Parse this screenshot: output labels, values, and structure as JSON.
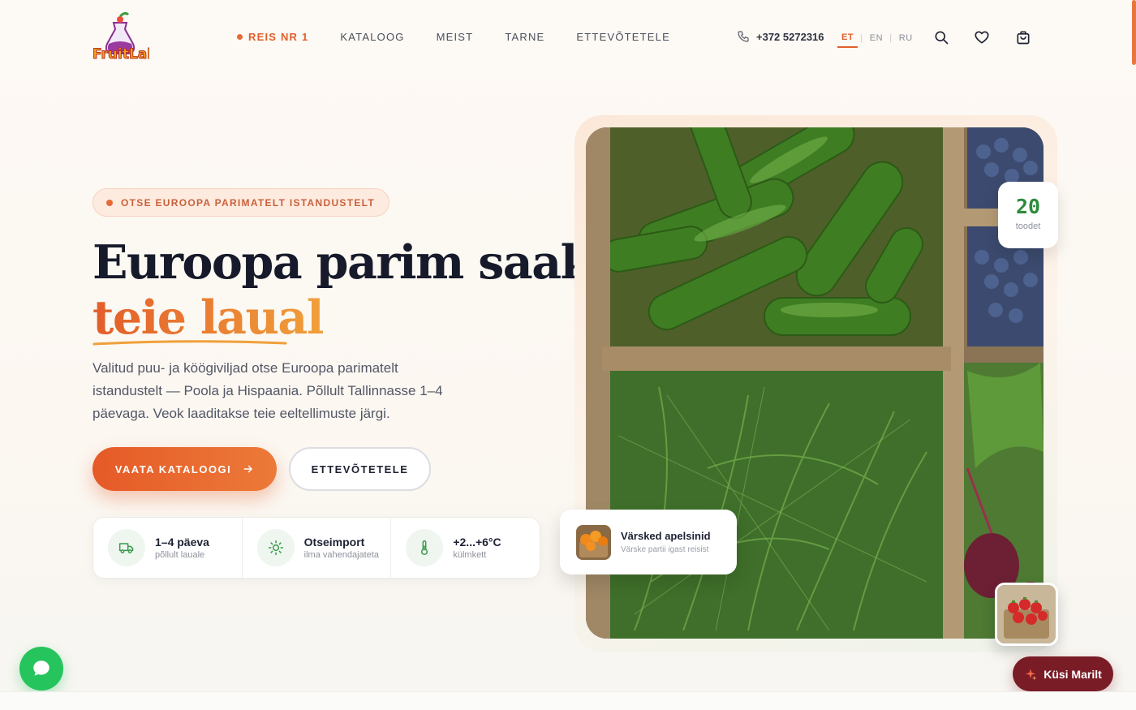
{
  "brand": {
    "logo_text": "FruitLab"
  },
  "nav": {
    "items": [
      {
        "label": "REIS NR 1",
        "active": true
      },
      {
        "label": "KATALOOG",
        "active": false
      },
      {
        "label": "MEIST",
        "active": false
      },
      {
        "label": "TARNE",
        "active": false
      },
      {
        "label": "ETTEVÕTETELE",
        "active": false
      }
    ]
  },
  "header": {
    "phone": "+372 5272316",
    "languages": [
      "ET",
      "EN",
      "RU"
    ],
    "active_language": "ET",
    "icons": [
      "phone-icon",
      "search-icon",
      "heart-icon",
      "cart-icon"
    ]
  },
  "hero": {
    "badge": "OTSE EUROOPA PARIMATELT ISTANDUSTELT",
    "title_line1": "Euroopa parim saak",
    "title_line2": "teie laual",
    "description": "Valitud puu- ja köögiviljad otse Euroopa parimatelt istandustelt — Poola ja Hispaania. Põllult Tallinnasse 1–4 päevaga. Veok laaditakse teie eeltellimuste järgi.",
    "primary_cta": "VAATA KATALOOGI",
    "secondary_cta": "ETTEVÕTETELE"
  },
  "features": [
    {
      "title": "1–4 päeva",
      "subtitle": "põllult lauale",
      "icon": "truck-icon"
    },
    {
      "title": "Otseimport",
      "subtitle": "ilma vahendajateta",
      "icon": "sun-icon"
    },
    {
      "title": "+2...+6°C",
      "subtitle": "külmkett",
      "icon": "thermometer-icon"
    }
  ],
  "stats_card": {
    "number": "20",
    "label": "toodet"
  },
  "promo_card": {
    "title": "Värsked apelsinid",
    "subtitle": "Värske partii igast reisist"
  },
  "widgets": {
    "ask_label": "Küsi Marilt"
  },
  "colors": {
    "accent": "#e0602a",
    "green": "#2e8b3e",
    "maroon": "#7a1c26",
    "chat": "#25c45c"
  }
}
